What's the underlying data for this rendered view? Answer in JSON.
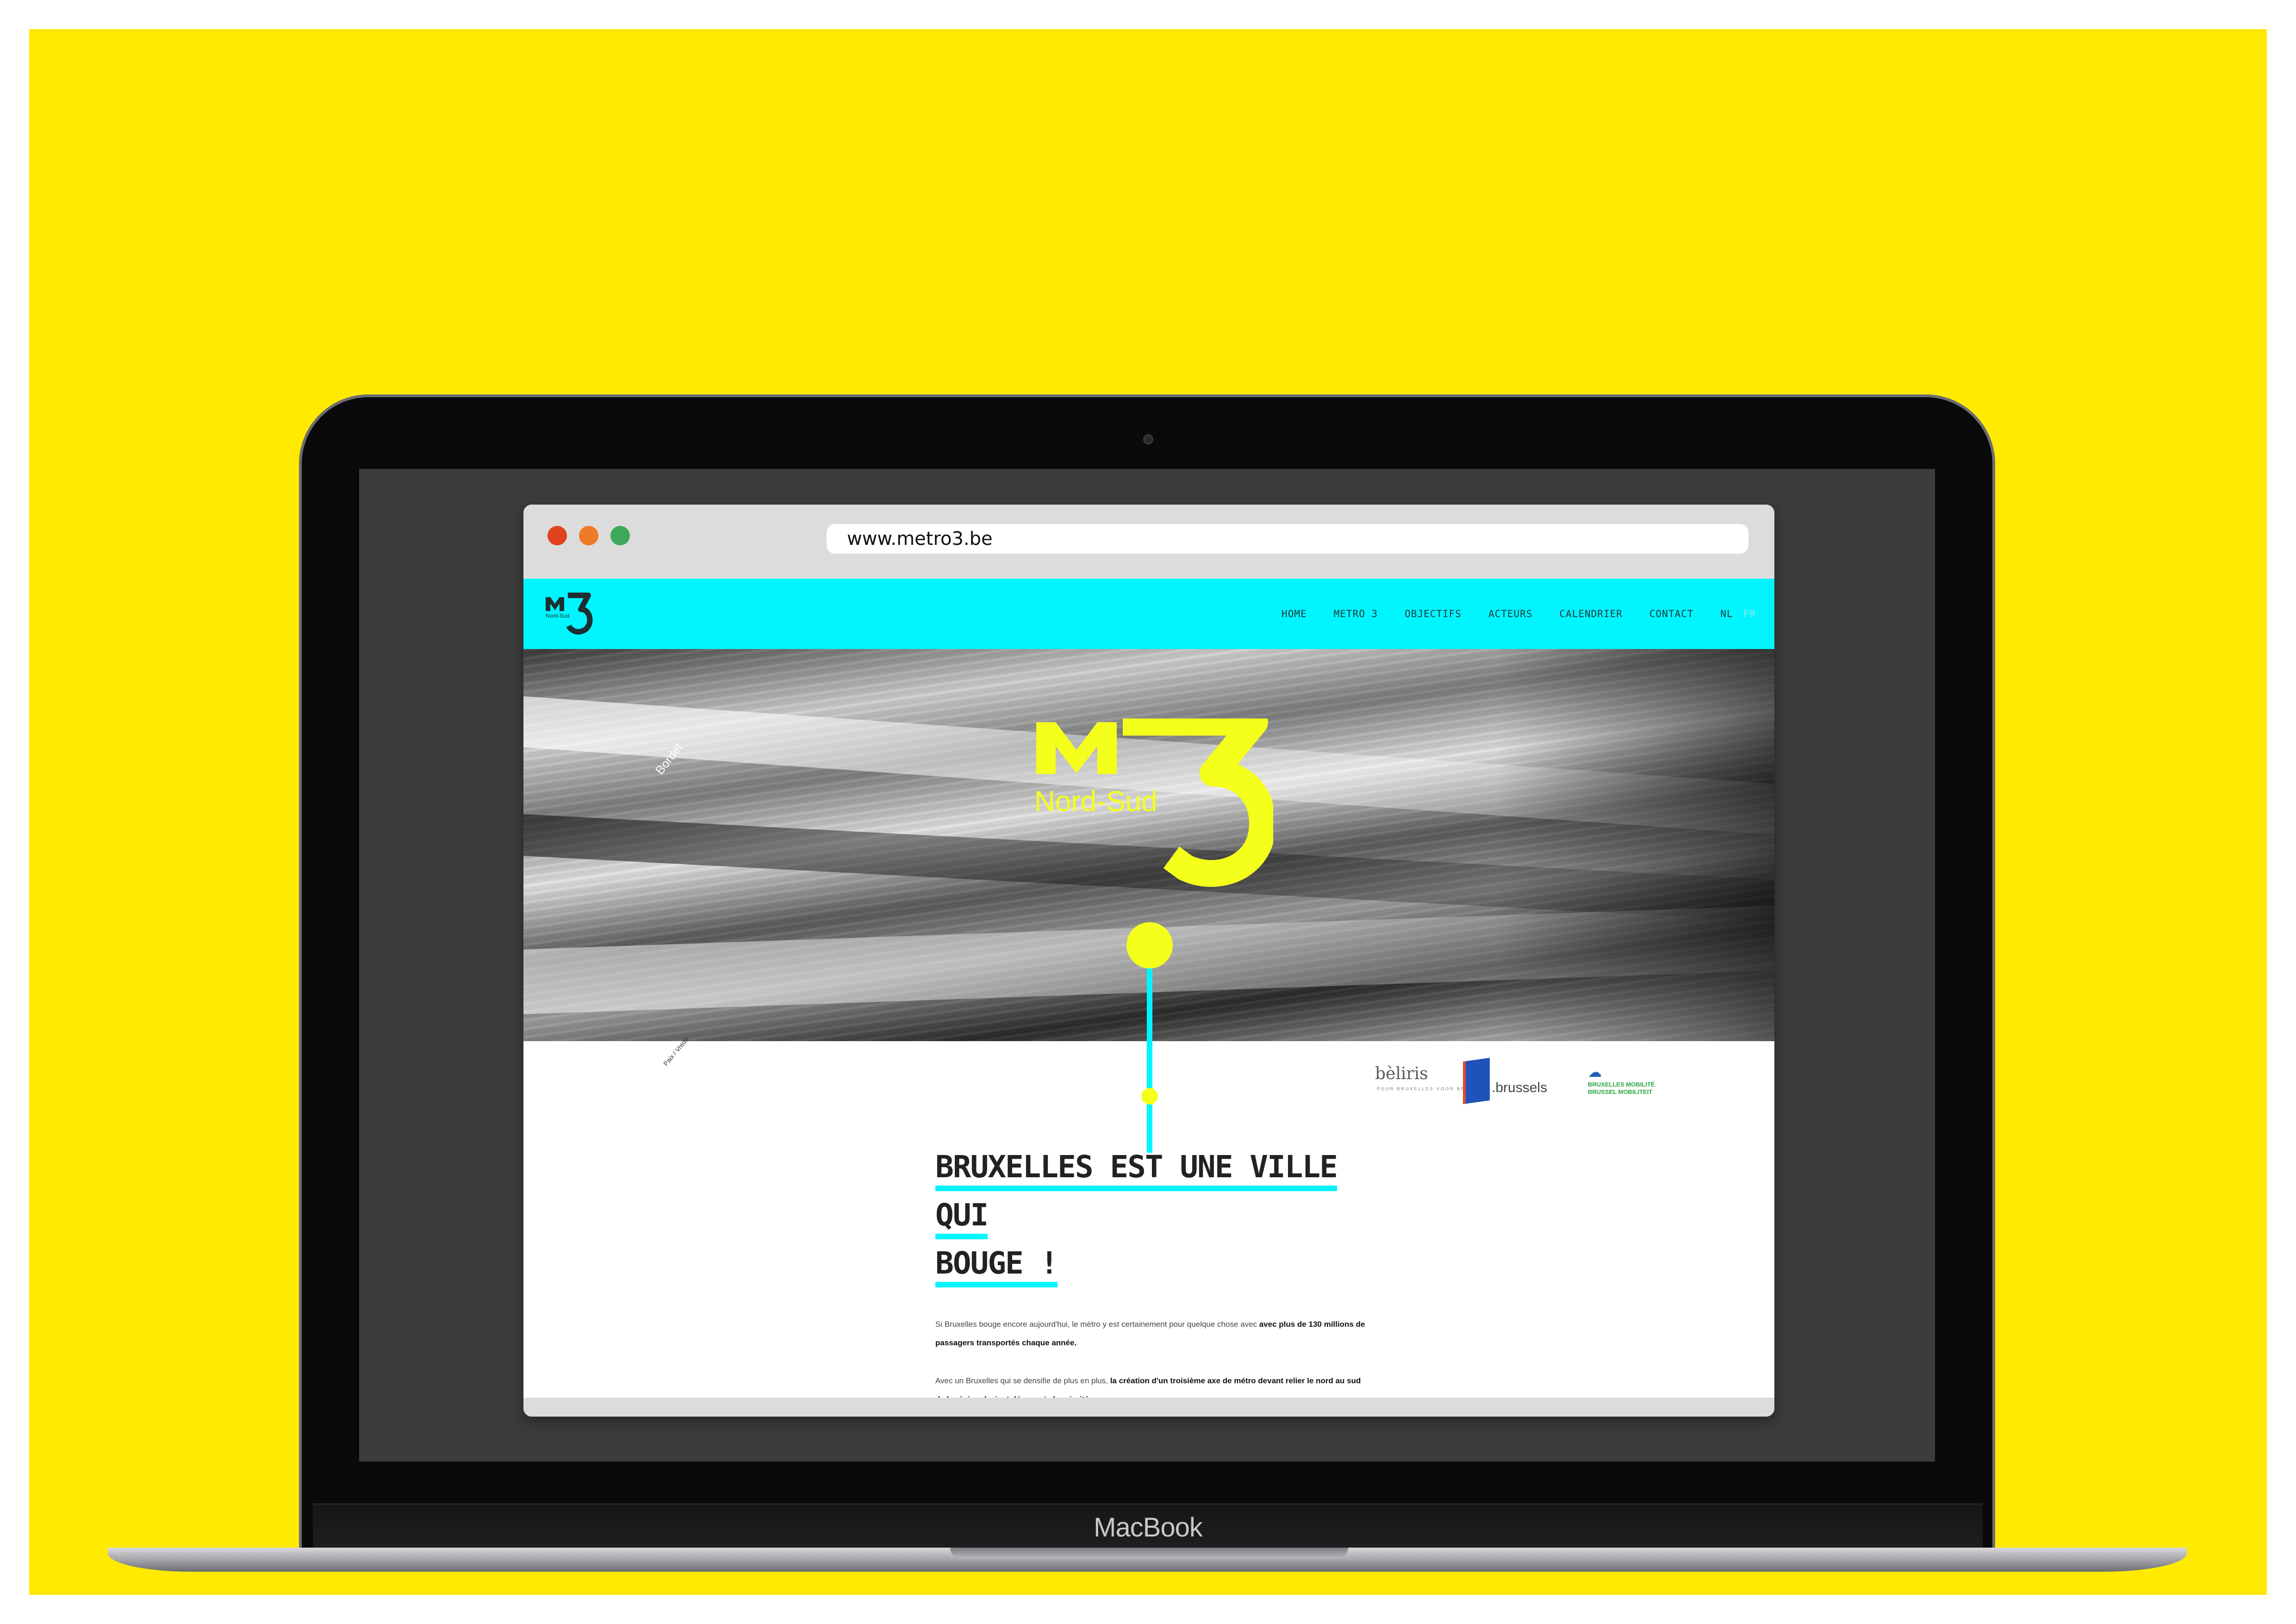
{
  "browser": {
    "url": "www.metro3.be"
  },
  "nav": {
    "items": [
      {
        "label": "HOME"
      },
      {
        "label": "METRO 3"
      },
      {
        "label": "OBJECTIFS"
      },
      {
        "label": "ACTEURS"
      },
      {
        "label": "CALENDRIER"
      },
      {
        "label": "CONTACT"
      }
    ],
    "lang": [
      "NL",
      "FR"
    ],
    "active_lang": "FR"
  },
  "hero": {
    "logo_letters": "M",
    "logo_number": "3",
    "logo_subtitle": "Nord-Sud",
    "station_top": "Bordet",
    "station_bottom": "Paix / Vrede"
  },
  "partners": {
    "beliris": "bèliris",
    "beliris_sub": "POUR BRUXELLES VOOR BRUSSEL",
    "brussels": ".brussels",
    "mobilite_line1": "BRUXELLES MOBILITÉ",
    "mobilite_line2": "BRUSSEL MOBILITEIT"
  },
  "article": {
    "headline_line1": "BRUXELLES EST UNE VILLE QUI",
    "headline_line2": "BOUGE !",
    "p1_plain": "Si Bruxelles bouge encore aujourd'hui, le métro y est certainement pour quelque chose avec ",
    "p1_bold": "avec plus de 130 millions de passagers transportés chaque année.",
    "p2_plain": "Avec un Bruxelles qui se densifie de plus en plus, ",
    "p2_bold": "la création d'un troisième axe de métro devant relier le nord au sud de la région devient désormais la priorité."
  },
  "device": {
    "brand": "MacBook"
  },
  "colors": {
    "background": "#ffea00",
    "accent_cyan": "#00f5ff",
    "logo_yellow": "#f4ff1c"
  }
}
